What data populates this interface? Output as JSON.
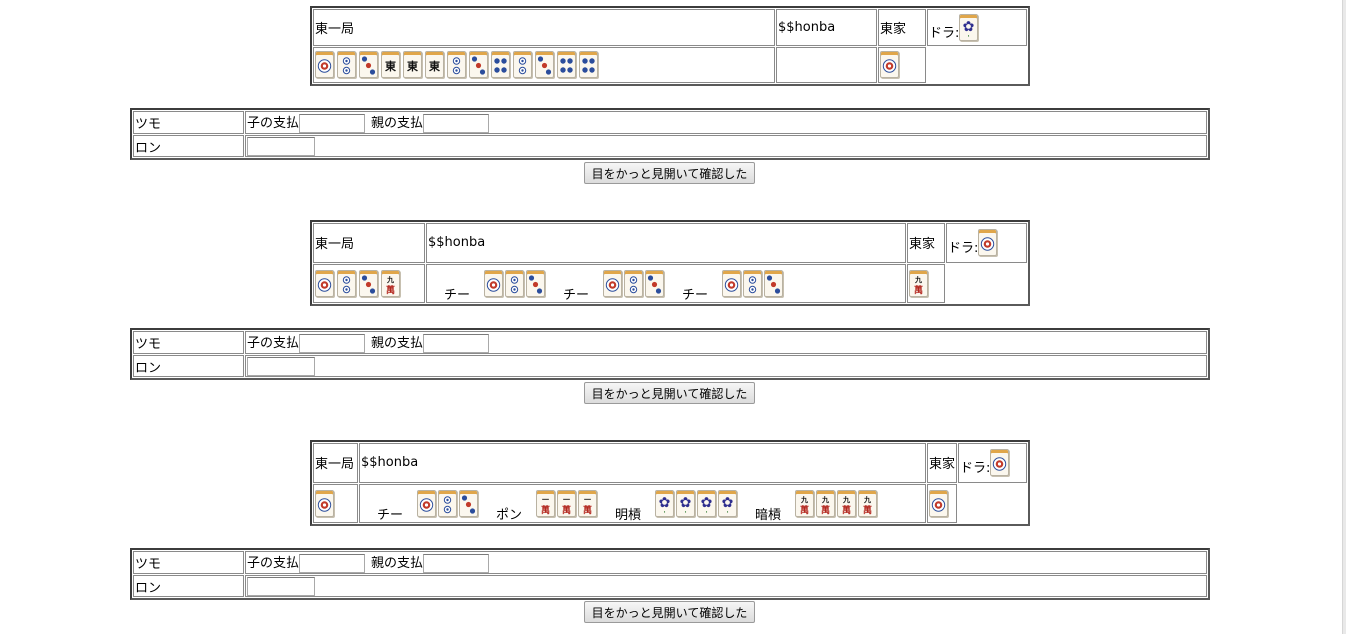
{
  "colors": {
    "tile_face": "#fbf7ee",
    "tile_back": "#e0a64a",
    "pin_blue": "#2b4d9c",
    "pin_red": "#c23a2a",
    "char_red": "#b3271f"
  },
  "labels": {
    "round": "東一局",
    "honba": "$$honba",
    "seat": "東家",
    "dora": "ドラ:",
    "tsumo": "ツモ",
    "ron": "ロン",
    "child_pay": "子の支払",
    "parent_pay": "親の支払",
    "confirm": "目をかっと見開いて確認した"
  },
  "problems": [
    {
      "dora": "9s",
      "hand": [
        "1p",
        "2p",
        "3p",
        "east",
        "east",
        "east",
        "2p",
        "3p",
        "4p",
        "2p",
        "3p",
        "4p",
        "4p"
      ],
      "melds": [],
      "draw": "1p"
    },
    {
      "dora": "1p",
      "hand": [
        "1p",
        "2p",
        "3p",
        "9m"
      ],
      "melds": [
        {
          "type": "チー",
          "tiles": [
            "1p",
            "2p",
            "3p"
          ]
        },
        {
          "type": "チー",
          "tiles": [
            "1p",
            "2p",
            "3p"
          ]
        },
        {
          "type": "チー",
          "tiles": [
            "1p",
            "2p",
            "3p"
          ]
        }
      ],
      "draw": "9m"
    },
    {
      "dora": "1p",
      "hand": [
        "1p"
      ],
      "melds": [
        {
          "type": "チー",
          "tiles": [
            "1p",
            "2p",
            "3p"
          ]
        },
        {
          "type": "ポン",
          "tiles": [
            "1m",
            "1m",
            "1m"
          ]
        },
        {
          "type": "明槓",
          "tiles": [
            "9s",
            "9s",
            "9s",
            "9s"
          ]
        },
        {
          "type": "暗槓",
          "tiles": [
            "9m",
            "9m",
            "9m",
            "9m"
          ]
        }
      ],
      "draw": "1p"
    }
  ]
}
